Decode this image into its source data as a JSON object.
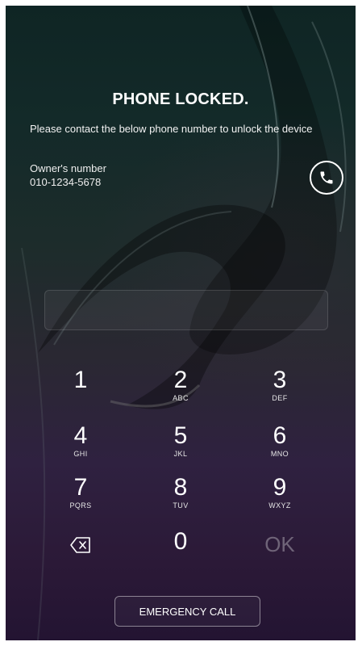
{
  "lock": {
    "title": "PHONE LOCKED.",
    "message": "Please contact the below phone number to unlock the device",
    "owner_label": "Owner's number",
    "owner_number": "010-1234-5678",
    "call_icon": "phone-icon"
  },
  "keypad": {
    "keys": [
      {
        "digit": "1",
        "letters": ""
      },
      {
        "digit": "2",
        "letters": "ABC"
      },
      {
        "digit": "3",
        "letters": "DEF"
      },
      {
        "digit": "4",
        "letters": "GHI"
      },
      {
        "digit": "5",
        "letters": "JKL"
      },
      {
        "digit": "6",
        "letters": "MNO"
      },
      {
        "digit": "7",
        "letters": "PQRS"
      },
      {
        "digit": "8",
        "letters": "TUV"
      },
      {
        "digit": "9",
        "letters": "WXYZ"
      },
      {
        "digit": "0",
        "letters": ""
      }
    ],
    "ok_label": "OK",
    "backspace_icon": "backspace-icon"
  },
  "emergency": {
    "label": "EMERGENCY CALL"
  },
  "colors": {
    "background_top": "#0f2524",
    "background_bottom": "#231432",
    "text": "#ffffff",
    "ok_disabled": "rgba(255,255,255,0.32)"
  }
}
